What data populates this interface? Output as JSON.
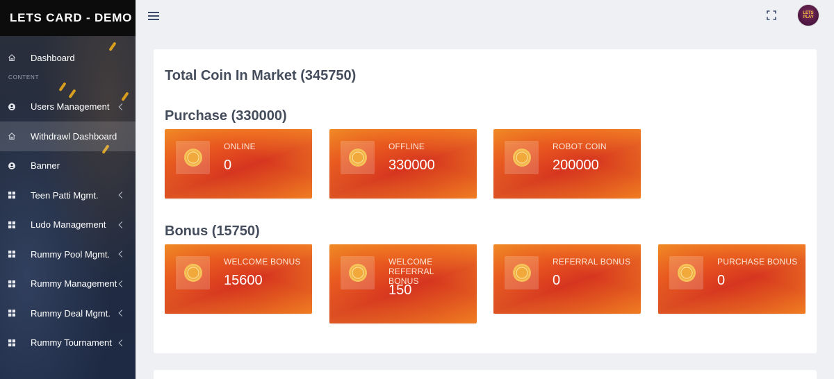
{
  "app": {
    "brand": "LETS CARD - DEMO"
  },
  "sidebar": {
    "section_label": "CONTENT",
    "items": [
      {
        "label": "Dashboard",
        "icon": "home-icon"
      },
      {
        "label": "Users Management",
        "icon": "user-icon"
      },
      {
        "label": "Withdrawl Dashboard",
        "icon": "home-icon"
      },
      {
        "label": "Banner",
        "icon": "user-icon"
      },
      {
        "label": "Teen Patti Mgmt.",
        "icon": "grid-icon"
      },
      {
        "label": "Ludo Management",
        "icon": "grid-icon"
      },
      {
        "label": "Rummy Pool Mgmt.",
        "icon": "grid-icon"
      },
      {
        "label": "Rummy Management",
        "icon": "grid-icon"
      },
      {
        "label": "Rummy Deal Mgmt.",
        "icon": "grid-icon"
      },
      {
        "label": "Rummy Tournament",
        "icon": "grid-icon"
      }
    ]
  },
  "header": {
    "avatar_text": "LETS PLAY"
  },
  "main": {
    "total_title": "Total Coin In Market (345750)",
    "purchase": {
      "title": "Purchase (330000)",
      "cards": [
        {
          "label": "ONLINE",
          "value": "0"
        },
        {
          "label": "OFFLINE",
          "value": "330000"
        },
        {
          "label": "ROBOT COIN",
          "value": "200000"
        }
      ]
    },
    "bonus": {
      "title": "Bonus (15750)",
      "cards": [
        {
          "label": "WELCOME BONUS",
          "value": "15600"
        },
        {
          "label": "WELCOME REFERRAL BONUS",
          "value": "150"
        },
        {
          "label": "REFERRAL BONUS",
          "value": "0"
        },
        {
          "label": "PURCHASE BONUS",
          "value": "0"
        }
      ]
    }
  },
  "colors": {
    "brand_bar": "#0c0c0c",
    "sidebar": "#1c2535",
    "card_orange": "#e8561f",
    "card_red": "#d6351f"
  }
}
